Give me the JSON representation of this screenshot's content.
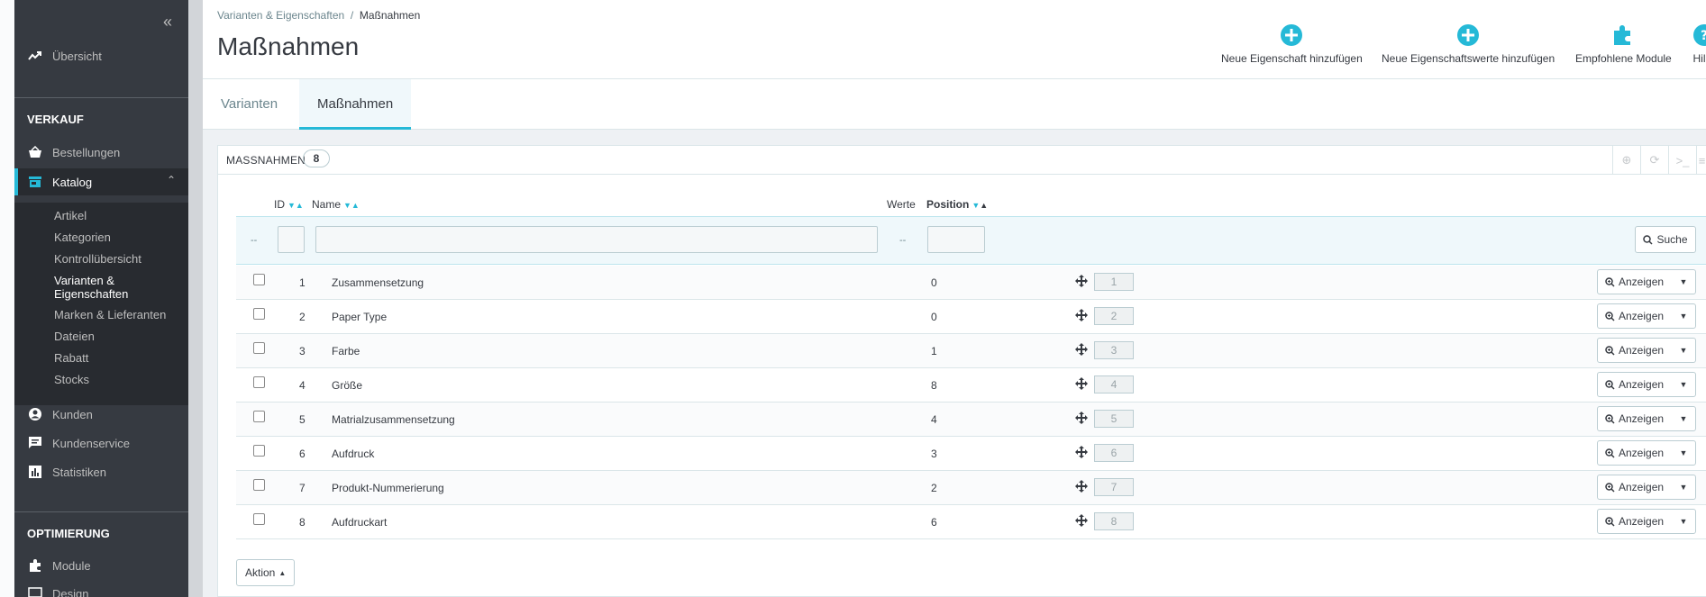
{
  "sidebar": {
    "collapse_label": "«",
    "overview": "Übersicht",
    "section_sales": "VERKAUF",
    "orders": "Bestellungen",
    "catalog": "Katalog",
    "catalog_sub": [
      "Artikel",
      "Kategorien",
      "Kontrollübersicht",
      "Varianten &",
      "Eigenschaften",
      "Marken & Lieferanten",
      "Dateien",
      "Rabatt",
      "Stocks"
    ],
    "customers": "Kunden",
    "customer_service": "Kundenservice",
    "stats": "Statistiken",
    "section_opt": "OPTIMIERUNG",
    "modules": "Module",
    "design": "Design"
  },
  "header": {
    "breadcrumb_parent": "Varianten & Eigenschaften",
    "breadcrumb_sep": "/",
    "breadcrumb_current": "Maßnahmen",
    "title": "Maßnahmen",
    "btn_new_feature": "Neue Eigenschaft hinzufügen",
    "btn_new_value": "Neue Eigenschaftswerte hinzufügen",
    "btn_modules": "Empfohlene Module",
    "btn_help": "Hil"
  },
  "tabs": {
    "variants": "Varianten",
    "features": "Maßnahmen"
  },
  "panel": {
    "title": "MASSNAHMEN",
    "count": "8",
    "columns": {
      "id": "ID",
      "name": "Name",
      "values": "Werte",
      "position": "Position"
    },
    "filter_dash": "--",
    "search_label": "Suche",
    "view_label": "Anzeigen",
    "bulk_label": "Aktion"
  },
  "rows": [
    {
      "id": "1",
      "name": "Zusammensetzung",
      "values": "0",
      "position": "1"
    },
    {
      "id": "2",
      "name": "Paper Type",
      "values": "0",
      "position": "2"
    },
    {
      "id": "3",
      "name": "Farbe",
      "values": "1",
      "position": "3"
    },
    {
      "id": "4",
      "name": "Größe",
      "values": "8",
      "position": "4"
    },
    {
      "id": "5",
      "name": "Matrialzusammensetzung",
      "values": "4",
      "position": "5"
    },
    {
      "id": "6",
      "name": "Aufdruck",
      "values": "3",
      "position": "6"
    },
    {
      "id": "7",
      "name": "Produkt-Nummerierung",
      "values": "2",
      "position": "7"
    },
    {
      "id": "8",
      "name": "Aufdruckart",
      "values": "6",
      "position": "8"
    }
  ],
  "colors": {
    "accent": "#25b9d7",
    "sidebar": "#363a41",
    "sidebar_active": "#282b30"
  }
}
